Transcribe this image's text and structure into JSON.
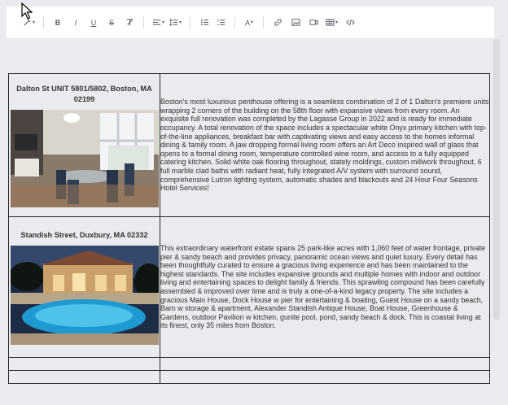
{
  "toolbar": {
    "buttons": [
      {
        "name": "magic-format-icon",
        "glyph": "✎"
      },
      {
        "name": "bold-icon",
        "glyph": "B"
      },
      {
        "name": "italic-icon",
        "glyph": "I"
      },
      {
        "name": "underline-icon",
        "glyph": "U"
      },
      {
        "name": "strikethrough-icon",
        "glyph": "S"
      },
      {
        "name": "clear-format-icon",
        "glyph": "T"
      },
      {
        "name": "align-icon",
        "glyph": "≡"
      },
      {
        "name": "line-height-icon",
        "glyph": "↕"
      },
      {
        "name": "bullet-list-icon",
        "glyph": "•"
      },
      {
        "name": "numbered-list-icon",
        "glyph": "1."
      },
      {
        "name": "text-color-icon",
        "glyph": "A"
      },
      {
        "name": "link-icon",
        "glyph": "🔗"
      },
      {
        "name": "image-icon",
        "glyph": "▣"
      },
      {
        "name": "video-icon",
        "glyph": "▶"
      },
      {
        "name": "table-icon",
        "glyph": "⊞"
      },
      {
        "name": "code-icon",
        "glyph": "</>"
      }
    ]
  },
  "listings": [
    {
      "address_line1": "Dalton St UNIT 5801/5802, Boston, MA",
      "address_line2": "02199",
      "photo_icon": "penthouse-interior-photo",
      "description": " Boston's most luxurious penthouse offering is a seamless combination of 2 of 1 Dalton's premiere units wrapping 2 corners of the building on the 58th floor with expansive views from every room. An exquisite full renovation was completed by the Lagasse Group in 2022 and is ready for immediate occupancy. A total renovation of the space includes a spectacular white Onyx primary kitchen with top-of-the-line appliances, breakfast bar with captivating views and easy access to the homes informal dining & family room. A jaw dropping formal living room offers an Art Deco inspired wall of glass that opens to a formal dining room, temperature controlled wine room, and access to a fully equipped catering kitchen. Solid white oak flooring throughout, stately moldings, custom millwork throughout, 6 full marble clad baths with radiant heat, fully integrated A/V system with surround sound, comprehensive Lutron lighting system, automatic shades and blackouts and 24 Hour Four Seasons Hotel Services!"
    },
    {
      "address_line1": "Standish Street, Duxbury, MA 02332",
      "address_line2": "",
      "photo_icon": "waterfront-estate-pool-photo",
      "description": " This extraordinary waterfront estate spans 25 park-like acres with 1,060 feet of water frontage, private pier & sandy beach and provides privacy, panoramic ocean views and quiet luxury. Every detail has been thoughtfully curated to ensure a gracious living experience and has been maintained to the highest standards. The site includes expansive grounds and multiple homes with indoor and outdoor living and entertaining spaces to delight family & friends. This sprawling compound has been carefully assembled & improved over time and is truly a one-of-a-kind legacy property. The site includes a gracious Main House, Dock House w pier for entertaining & boating, Guest House on a sandy beach, Barn w storage & apartment, Alexander Standish Antique House, Boat House, Greenhouse & Gardens, outdoor Pavilion w kitchen, gunite pool, pond, sandy beach & dock. This is coastal living at its finest, only 35 miles from Boston."
    }
  ],
  "colors": {
    "canvas": "#e9ebee",
    "toolbar": "#ffffff",
    "border": "#2a2a2a",
    "text": "#333333"
  }
}
